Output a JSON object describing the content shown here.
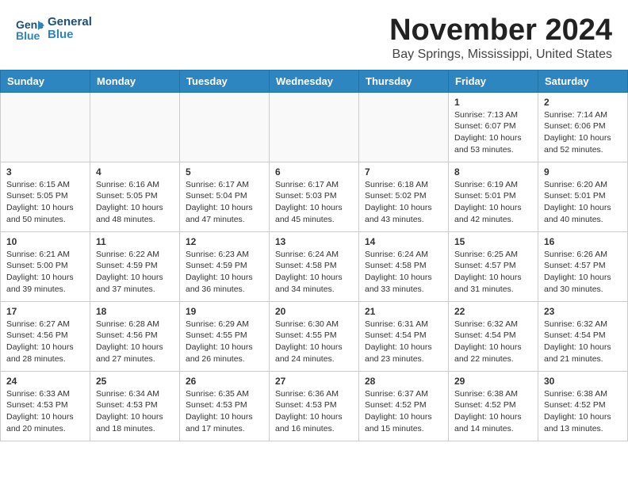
{
  "header": {
    "logo_line1": "General",
    "logo_line2": "Blue",
    "month": "November 2024",
    "location": "Bay Springs, Mississippi, United States"
  },
  "days_of_week": [
    "Sunday",
    "Monday",
    "Tuesday",
    "Wednesday",
    "Thursday",
    "Friday",
    "Saturday"
  ],
  "weeks": [
    [
      {
        "day": "",
        "content": ""
      },
      {
        "day": "",
        "content": ""
      },
      {
        "day": "",
        "content": ""
      },
      {
        "day": "",
        "content": ""
      },
      {
        "day": "",
        "content": ""
      },
      {
        "day": "1",
        "content": "Sunrise: 7:13 AM\nSunset: 6:07 PM\nDaylight: 10 hours and 53 minutes."
      },
      {
        "day": "2",
        "content": "Sunrise: 7:14 AM\nSunset: 6:06 PM\nDaylight: 10 hours and 52 minutes."
      }
    ],
    [
      {
        "day": "3",
        "content": "Sunrise: 6:15 AM\nSunset: 5:05 PM\nDaylight: 10 hours and 50 minutes."
      },
      {
        "day": "4",
        "content": "Sunrise: 6:16 AM\nSunset: 5:05 PM\nDaylight: 10 hours and 48 minutes."
      },
      {
        "day": "5",
        "content": "Sunrise: 6:17 AM\nSunset: 5:04 PM\nDaylight: 10 hours and 47 minutes."
      },
      {
        "day": "6",
        "content": "Sunrise: 6:17 AM\nSunset: 5:03 PM\nDaylight: 10 hours and 45 minutes."
      },
      {
        "day": "7",
        "content": "Sunrise: 6:18 AM\nSunset: 5:02 PM\nDaylight: 10 hours and 43 minutes."
      },
      {
        "day": "8",
        "content": "Sunrise: 6:19 AM\nSunset: 5:01 PM\nDaylight: 10 hours and 42 minutes."
      },
      {
        "day": "9",
        "content": "Sunrise: 6:20 AM\nSunset: 5:01 PM\nDaylight: 10 hours and 40 minutes."
      }
    ],
    [
      {
        "day": "10",
        "content": "Sunrise: 6:21 AM\nSunset: 5:00 PM\nDaylight: 10 hours and 39 minutes."
      },
      {
        "day": "11",
        "content": "Sunrise: 6:22 AM\nSunset: 4:59 PM\nDaylight: 10 hours and 37 minutes."
      },
      {
        "day": "12",
        "content": "Sunrise: 6:23 AM\nSunset: 4:59 PM\nDaylight: 10 hours and 36 minutes."
      },
      {
        "day": "13",
        "content": "Sunrise: 6:24 AM\nSunset: 4:58 PM\nDaylight: 10 hours and 34 minutes."
      },
      {
        "day": "14",
        "content": "Sunrise: 6:24 AM\nSunset: 4:58 PM\nDaylight: 10 hours and 33 minutes."
      },
      {
        "day": "15",
        "content": "Sunrise: 6:25 AM\nSunset: 4:57 PM\nDaylight: 10 hours and 31 minutes."
      },
      {
        "day": "16",
        "content": "Sunrise: 6:26 AM\nSunset: 4:57 PM\nDaylight: 10 hours and 30 minutes."
      }
    ],
    [
      {
        "day": "17",
        "content": "Sunrise: 6:27 AM\nSunset: 4:56 PM\nDaylight: 10 hours and 28 minutes."
      },
      {
        "day": "18",
        "content": "Sunrise: 6:28 AM\nSunset: 4:56 PM\nDaylight: 10 hours and 27 minutes."
      },
      {
        "day": "19",
        "content": "Sunrise: 6:29 AM\nSunset: 4:55 PM\nDaylight: 10 hours and 26 minutes."
      },
      {
        "day": "20",
        "content": "Sunrise: 6:30 AM\nSunset: 4:55 PM\nDaylight: 10 hours and 24 minutes."
      },
      {
        "day": "21",
        "content": "Sunrise: 6:31 AM\nSunset: 4:54 PM\nDaylight: 10 hours and 23 minutes."
      },
      {
        "day": "22",
        "content": "Sunrise: 6:32 AM\nSunset: 4:54 PM\nDaylight: 10 hours and 22 minutes."
      },
      {
        "day": "23",
        "content": "Sunrise: 6:32 AM\nSunset: 4:54 PM\nDaylight: 10 hours and 21 minutes."
      }
    ],
    [
      {
        "day": "24",
        "content": "Sunrise: 6:33 AM\nSunset: 4:53 PM\nDaylight: 10 hours and 20 minutes."
      },
      {
        "day": "25",
        "content": "Sunrise: 6:34 AM\nSunset: 4:53 PM\nDaylight: 10 hours and 18 minutes."
      },
      {
        "day": "26",
        "content": "Sunrise: 6:35 AM\nSunset: 4:53 PM\nDaylight: 10 hours and 17 minutes."
      },
      {
        "day": "27",
        "content": "Sunrise: 6:36 AM\nSunset: 4:53 PM\nDaylight: 10 hours and 16 minutes."
      },
      {
        "day": "28",
        "content": "Sunrise: 6:37 AM\nSunset: 4:52 PM\nDaylight: 10 hours and 15 minutes."
      },
      {
        "day": "29",
        "content": "Sunrise: 6:38 AM\nSunset: 4:52 PM\nDaylight: 10 hours and 14 minutes."
      },
      {
        "day": "30",
        "content": "Sunrise: 6:38 AM\nSunset: 4:52 PM\nDaylight: 10 hours and 13 minutes."
      }
    ]
  ]
}
